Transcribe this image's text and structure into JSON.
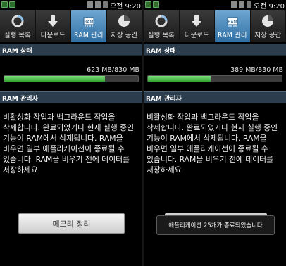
{
  "left": {
    "status_time": "오전 9:20",
    "tabs": [
      {
        "label": "실행 목록",
        "icon": "running-list-icon"
      },
      {
        "label": "다운로드",
        "icon": "download-icon"
      },
      {
        "label": "RAM 관리",
        "icon": "ram-chip-icon",
        "active": true
      },
      {
        "label": "저장 공간",
        "icon": "storage-pie-icon"
      }
    ],
    "ram_status_header": "RAM 상태",
    "ram_usage": "623 MB/830 MB",
    "ram_used_fraction": 0.75,
    "ram_manager_header": "RAM 관리자",
    "description": "비활성화 작업과 백그라운드 작업을 삭제합니다. 완료되었거나 현재 실행 중인 기능이 RAM에서 삭제됩니다. RAM을 비우면 일부 애플리케이션이 종료될 수 있습니다. RAM을 비우기 전에 데이터를 저장하세요",
    "clear_button": "메모리 정리"
  },
  "right": {
    "status_time": "오전 9:20",
    "tabs": [
      {
        "label": "실행 목록",
        "icon": "running-list-icon"
      },
      {
        "label": "다운로드",
        "icon": "download-icon"
      },
      {
        "label": "RAM 관리",
        "icon": "ram-chip-icon",
        "active": true
      },
      {
        "label": "저장 공간",
        "icon": "storage-pie-icon"
      }
    ],
    "ram_status_header": "RAM 상태",
    "ram_usage": "389 MB/830 MB",
    "ram_used_fraction": 0.47,
    "ram_manager_header": "RAM 관리자",
    "description": "비활성화 작업과 백그라운드 작업을 삭제합니다. 완료되었거나 현재 실행 중인 기능이 RAM에서 삭제됩니다. RAM을 비우면 일부 애플리케이션이 종료될 수 있습니다. RAM을 비우기 전에 데이터를 저장하세요",
    "toast": "애플리케이션 25개가 종료되었습니다"
  },
  "colors": {
    "tab_active": "#4f8fc3",
    "section_header": "#2c3e4e",
    "bar_fill": "#4cc24c"
  }
}
